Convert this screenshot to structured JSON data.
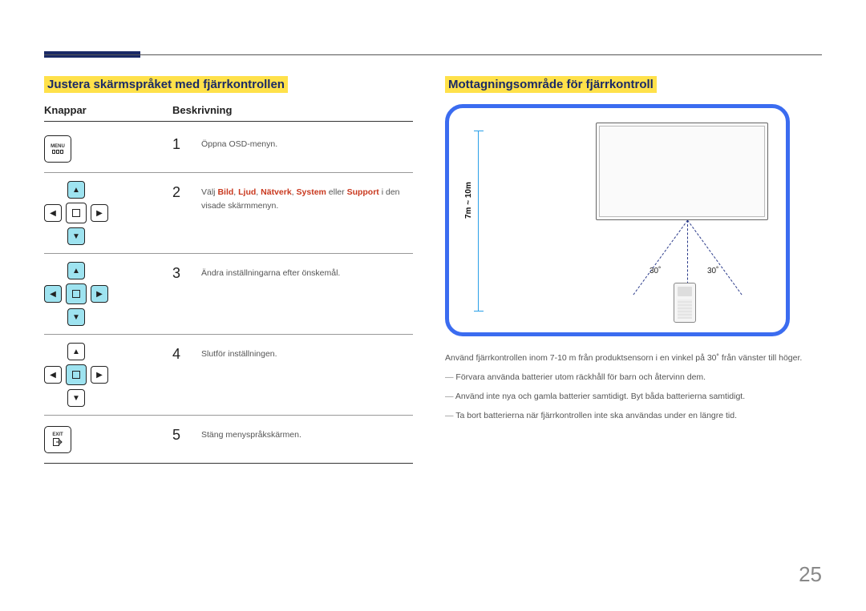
{
  "page_number": "25",
  "left": {
    "title": "Justera skärmspråket med fjärrkontrollen",
    "col_buttons": "Knappar",
    "col_desc": "Beskrivning",
    "rows": [
      {
        "num": "1",
        "icon": "menu",
        "desc_plain": "Öppna OSD-menyn."
      },
      {
        "num": "2",
        "icon": "dpad-ud",
        "desc_prefix": "Välj ",
        "desc_hl": [
          "Bild",
          "Ljud",
          "Nätverk",
          "System"
        ],
        "desc_mid": " eller ",
        "desc_hl_last": "Support",
        "desc_suffix": " i den visade skärmmenyn."
      },
      {
        "num": "3",
        "icon": "dpad-all",
        "desc_plain": "Ändra inställningarna efter önskemål."
      },
      {
        "num": "4",
        "icon": "dpad-center",
        "desc_plain": "Slutför inställningen."
      },
      {
        "num": "5",
        "icon": "exit",
        "desc_plain": "Stäng menyspråkskärmen."
      }
    ],
    "menu_label": "MENU",
    "exit_label": "EXIT"
  },
  "right": {
    "title": "Mottagningsområde för fjärrkontroll",
    "distance_label": "7m ~ 10m",
    "angle_left": "30˚",
    "angle_right": "30˚",
    "body": "Använd fjärrkontrollen inom 7-10 m från produktsensorn i en vinkel på 30˚ från vänster till höger.",
    "notes": [
      "Förvara använda batterier utom räckhåll för barn och återvinn dem.",
      "Använd inte nya och gamla batterier samtidigt. Byt båda batterierna samtidigt.",
      "Ta bort batterierna när fjärrkontrollen inte ska användas under en längre tid."
    ]
  }
}
